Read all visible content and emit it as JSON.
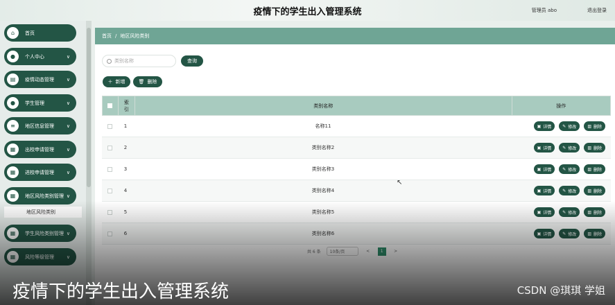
{
  "header": {
    "title": "疫情下的学生出入管理系统",
    "user": "管理员 abo",
    "logout": "退出登录"
  },
  "sidebar": {
    "items": [
      {
        "label": "首页",
        "icon": "home-icon",
        "chevron": ""
      },
      {
        "label": "个人中心",
        "icon": "person-icon",
        "chevron": "∨"
      },
      {
        "label": "疫情动态管理",
        "icon": "document-icon",
        "chevron": "∨"
      },
      {
        "label": "学生管理",
        "icon": "person-icon",
        "chevron": "∨"
      },
      {
        "label": "地区信息管理",
        "icon": "list-icon",
        "chevron": "∨"
      },
      {
        "label": "出校申请管理",
        "icon": "grid-icon",
        "chevron": "∨"
      },
      {
        "label": "进校申请管理",
        "icon": "grid-icon",
        "chevron": "∨"
      },
      {
        "label": "地区风险类别管理",
        "icon": "grid-icon",
        "chevron": "∨"
      },
      {
        "label": "学生风险类别管理",
        "icon": "grid-icon",
        "chevron": "∨"
      },
      {
        "label": "风险等级管理",
        "icon": "grid-icon",
        "chevron": "∨"
      }
    ],
    "submenu_active": "地区风险类别"
  },
  "breadcrumb": {
    "home": "首页",
    "separator": "/",
    "current": "地区风险类别"
  },
  "toolbar": {
    "search_placeholder": "类别名称",
    "query_label": "查询",
    "add_label": "新增",
    "delete_label": "删除"
  },
  "table": {
    "headers": {
      "index": "索引",
      "name": "类别名称",
      "ops": "操作"
    },
    "rows": [
      {
        "index": "1",
        "name": "名称11"
      },
      {
        "index": "2",
        "name": "类别名称2"
      },
      {
        "index": "3",
        "name": "类别名称3"
      },
      {
        "index": "4",
        "name": "类别名称4"
      },
      {
        "index": "5",
        "name": "类别名称5"
      },
      {
        "index": "6",
        "name": "类别名称6"
      }
    ],
    "ops": {
      "detail": "详情",
      "edit": "修改",
      "delete": "删除"
    }
  },
  "pagination": {
    "total": "共 6 条",
    "page_size": "10条/页",
    "prev": "<",
    "current_page": "1",
    "next": ">"
  },
  "overlay": {
    "caption": "疫情下的学生出入管理系统",
    "watermark": "CSDN @琪琪 学姐"
  },
  "colors": {
    "primary": "#235545",
    "breadcrumb": "#6fa595",
    "table_header": "#a8cbbf",
    "page_active": "#2f8f6b"
  }
}
